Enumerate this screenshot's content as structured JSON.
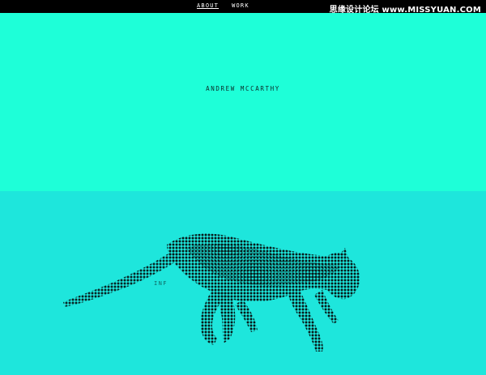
{
  "nav": {
    "items": [
      {
        "label": "ABOUT",
        "active": true
      },
      {
        "label": "WORK",
        "active": false
      }
    ]
  },
  "watermark": {
    "text": "思缘设计论坛 www.MISSYUAN.COM"
  },
  "hero": {
    "title": "ANDREW MCCARTHY"
  },
  "section": {
    "label": "INF"
  },
  "image": {
    "subject": "halftone-running-cat-icon"
  },
  "colors": {
    "topbar": "#000000",
    "hero_bg": "#1effd8",
    "section_bg": "#1ee6dc",
    "halftone": "#071a1a"
  }
}
